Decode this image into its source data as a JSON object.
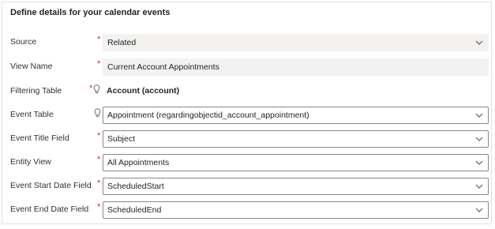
{
  "section": {
    "title": "Define details for your calendar events"
  },
  "fields": {
    "source": {
      "label": "Source",
      "value": "Related"
    },
    "view_name": {
      "label": "View Name",
      "value": "Current Account Appointments"
    },
    "filtering_table": {
      "label": "Filtering Table",
      "value": "Account (account)"
    },
    "event_table": {
      "label": "Event Table",
      "value": "Appointment (regardingobjectid_account_appointment)"
    },
    "event_title_field": {
      "label": "Event Title Field",
      "value": "Subject"
    },
    "entity_view": {
      "label": "Entity View",
      "value": "All Appointments"
    },
    "event_start_date_field": {
      "label": "Event Start Date Field",
      "value": "ScheduledStart"
    },
    "event_end_date_field": {
      "label": "Event End Date Field",
      "value": "ScheduledEnd"
    }
  },
  "required_marker": "*",
  "icons": {
    "chevron": "chevron-down-icon",
    "recommended": "lightbulb-icon"
  },
  "colors": {
    "required": "#c4314b",
    "field_border": "#8a8886",
    "readonly_bg": "#f3f2f1"
  }
}
